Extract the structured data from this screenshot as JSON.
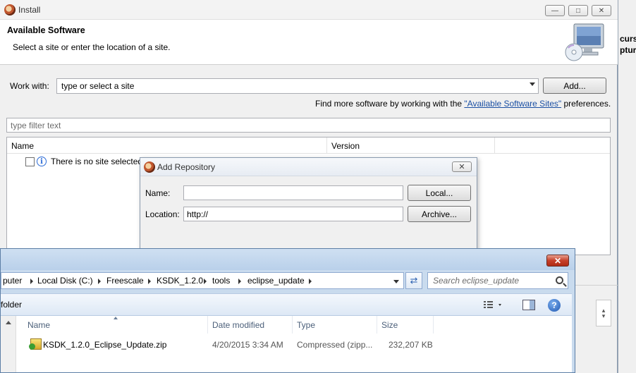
{
  "install": {
    "title": "Install",
    "header_title": "Available Software",
    "header_desc": "Select a site or enter the location of a site.",
    "work_with_label": "Work with:",
    "work_with_value": "type or select a site",
    "add_button": "Add...",
    "find_more_prefix": "Find more software by working with the ",
    "find_more_link": "\"Available Software Sites\"",
    "find_more_suffix": " preferences.",
    "filter_placeholder": "type filter text",
    "columns": [
      "Name",
      "Version"
    ],
    "row_text": "There is no site selected."
  },
  "add_repository": {
    "title": "Add Repository",
    "name_label": "Name:",
    "name_value": "",
    "local_button": "Local...",
    "location_label": "Location:",
    "location_value": "http://",
    "archive_button": "Archive..."
  },
  "explorer": {
    "breadcrumb": [
      "puter",
      "Local Disk (C:)",
      "Freescale",
      "KSDK_1.2.0",
      "tools",
      "eclipse_update"
    ],
    "search_placeholder": "Search eclipse_update",
    "toolbar_label": "folder",
    "columns": [
      "Name",
      "Date modified",
      "Type",
      "Size"
    ],
    "files": [
      {
        "name": "KSDK_1.2.0_Eclipse_Update.zip",
        "date": "4/20/2015 3:34 AM",
        "type": "Compressed (zipp...",
        "size": "232,207 KB"
      }
    ]
  },
  "background_window": {
    "partial_text_1": "curs",
    "partial_text_2": "ptur"
  }
}
